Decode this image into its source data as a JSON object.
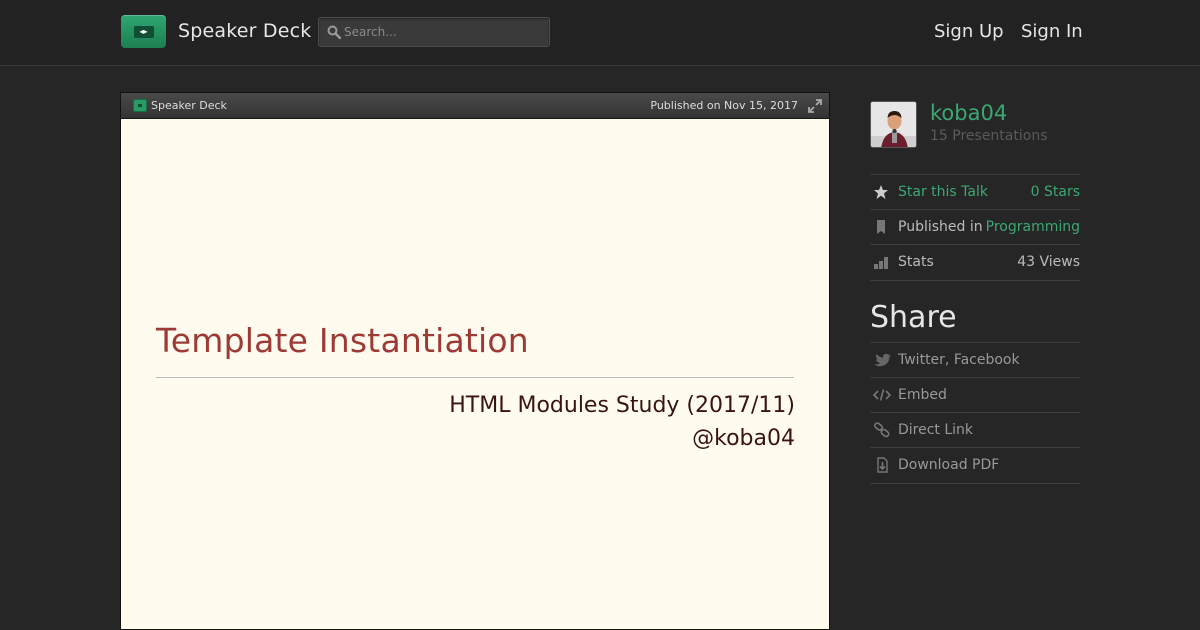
{
  "header": {
    "brand": "Speaker Deck",
    "search_placeholder": "Search...",
    "sign_up": "Sign Up",
    "sign_in": "Sign In"
  },
  "viewer": {
    "brand": "Speaker Deck",
    "published": "Published on Nov 15, 2017",
    "slide": {
      "title": "Template Instantiation",
      "subtitle": "HTML Modules Study (2017/11)",
      "author": "@koba04"
    }
  },
  "sidebar": {
    "username": "koba04",
    "presentations": "15 Presentations",
    "star_label": "Star this Talk",
    "star_value": "0 Stars",
    "published_label": "Published in",
    "published_value": "Programming",
    "stats_label": "Stats",
    "stats_value": "43 Views"
  },
  "share": {
    "title": "Share",
    "items": [
      "Twitter, Facebook",
      "Embed",
      "Direct Link",
      "Download PDF"
    ]
  },
  "colors": {
    "accent": "#3aa873",
    "slide_title": "#9e3a35",
    "slide_bg": "#fffcef",
    "page_bg": "#262626"
  }
}
